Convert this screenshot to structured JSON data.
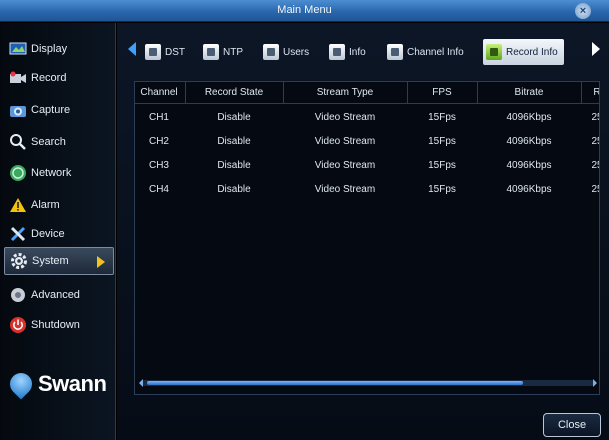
{
  "window": {
    "title": "Main Menu",
    "close_glyph": "×"
  },
  "sidebar": {
    "items": [
      {
        "label": "Display",
        "icon": "display-icon"
      },
      {
        "label": "Record",
        "icon": "record-icon"
      },
      {
        "label": "Capture",
        "icon": "capture-icon"
      },
      {
        "label": "Search",
        "icon": "search-icon"
      },
      {
        "label": "Network",
        "icon": "network-icon"
      },
      {
        "label": "Alarm",
        "icon": "alarm-icon"
      },
      {
        "label": "Device",
        "icon": "device-icon"
      },
      {
        "label": "System",
        "icon": "gear-icon",
        "active": true
      },
      {
        "label": "Advanced",
        "icon": "advanced-icon"
      },
      {
        "label": "Shutdown",
        "icon": "power-icon"
      }
    ]
  },
  "brand": {
    "name": "Swann"
  },
  "tabs": [
    {
      "label": "DST"
    },
    {
      "label": "NTP"
    },
    {
      "label": "Users"
    },
    {
      "label": "Info"
    },
    {
      "label": "Channel Info"
    },
    {
      "label": "Record Info",
      "active": true
    }
  ],
  "table": {
    "columns": [
      "Channel",
      "Record State",
      "Stream Type",
      "FPS",
      "Bitrate",
      "R"
    ],
    "rows": [
      [
        "CH1",
        "Disable",
        "Video Stream",
        "15Fps",
        "4096Kbps",
        "25"
      ],
      [
        "CH2",
        "Disable",
        "Video Stream",
        "15Fps",
        "4096Kbps",
        "25"
      ],
      [
        "CH3",
        "Disable",
        "Video Stream",
        "15Fps",
        "4096Kbps",
        "25"
      ],
      [
        "CH4",
        "Disable",
        "Video Stream",
        "15Fps",
        "4096Kbps",
        "25"
      ]
    ],
    "scroll_fraction": 0.85
  },
  "buttons": {
    "close_label": "Close"
  },
  "colors": {
    "accent": "#2a67ad",
    "active_arrow": "#f3c21a"
  }
}
